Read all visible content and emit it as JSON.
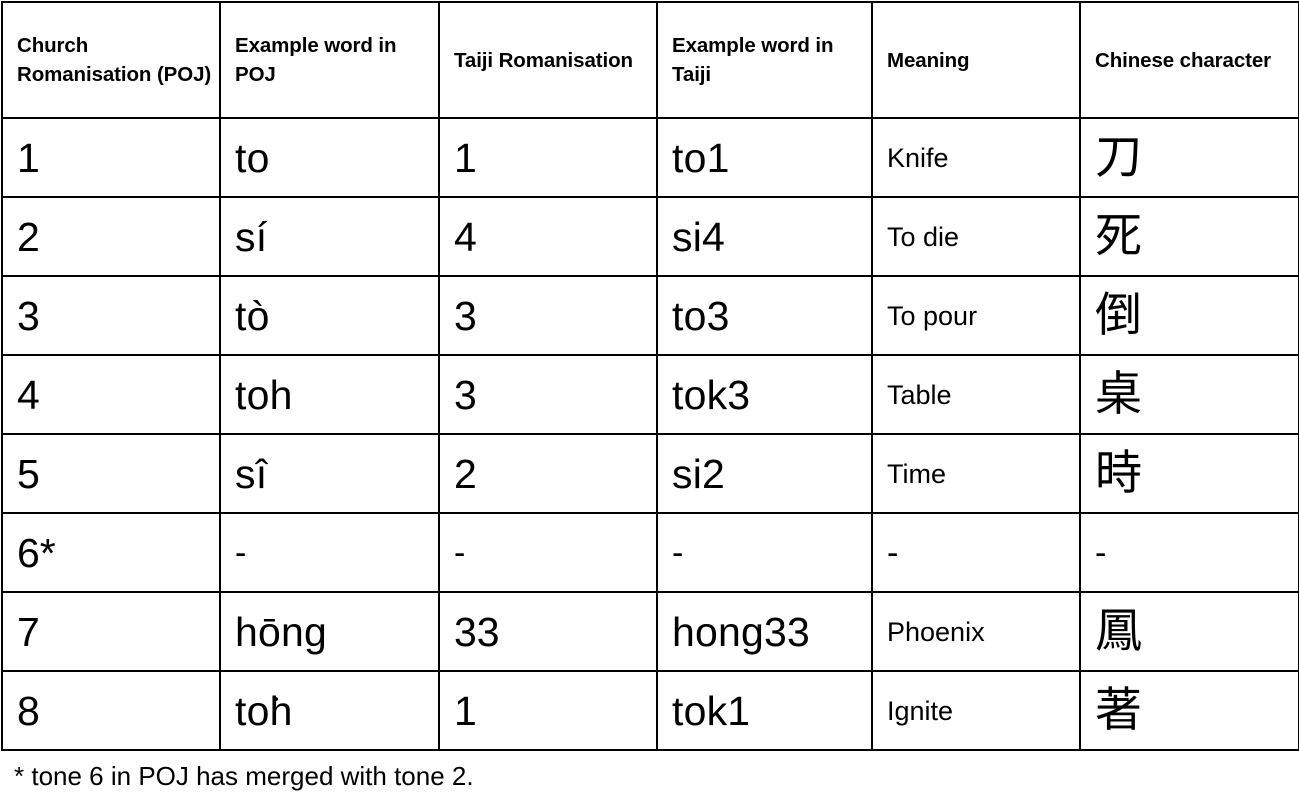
{
  "table": {
    "headers": [
      "Church Romanisation (POJ)",
      "Example word in POJ",
      "Taiji Romanisation",
      "Example word in Taiji",
      "Meaning",
      "Chinese character"
    ],
    "rows": [
      {
        "poj_tone": "1",
        "poj_word": "to",
        "taiji_tone": "1",
        "taiji_word": "to1",
        "meaning": "Knife",
        "hanzi": "刀"
      },
      {
        "poj_tone": "2",
        "poj_word": "sí",
        "taiji_tone": "4",
        "taiji_word": "si4",
        "meaning": "To die",
        "hanzi": "死"
      },
      {
        "poj_tone": "3",
        "poj_word": "tò",
        "taiji_tone": "3",
        "taiji_word": "to3",
        "meaning": "To pour",
        "hanzi": "倒"
      },
      {
        "poj_tone": "4",
        "poj_word": "toh",
        "taiji_tone": "3",
        "taiji_word": "tok3",
        "meaning": "Table",
        "hanzi": "桌"
      },
      {
        "poj_tone": "5",
        "poj_word": "sî",
        "taiji_tone": "2",
        "taiji_word": "si2",
        "meaning": "Time",
        "hanzi": "時"
      },
      {
        "poj_tone": "6*",
        "poj_word": "-",
        "taiji_tone": "-",
        "taiji_word": "-",
        "meaning": "-",
        "hanzi": "-"
      },
      {
        "poj_tone": "7",
        "poj_word": "hōng",
        "taiji_tone": "33",
        "taiji_word": "hong33",
        "meaning": "Phoenix",
        "hanzi": "鳳"
      },
      {
        "poj_tone": "8",
        "poj_word": "to͘h",
        "taiji_tone": "1",
        "taiji_word": "tok1",
        "meaning": "Ignite",
        "hanzi": "著"
      }
    ]
  },
  "footnote": "* tone 6 in POJ has merged with tone 2.",
  "colors": {
    "border": "#000000",
    "text": "#000000",
    "background": "#ffffff"
  }
}
